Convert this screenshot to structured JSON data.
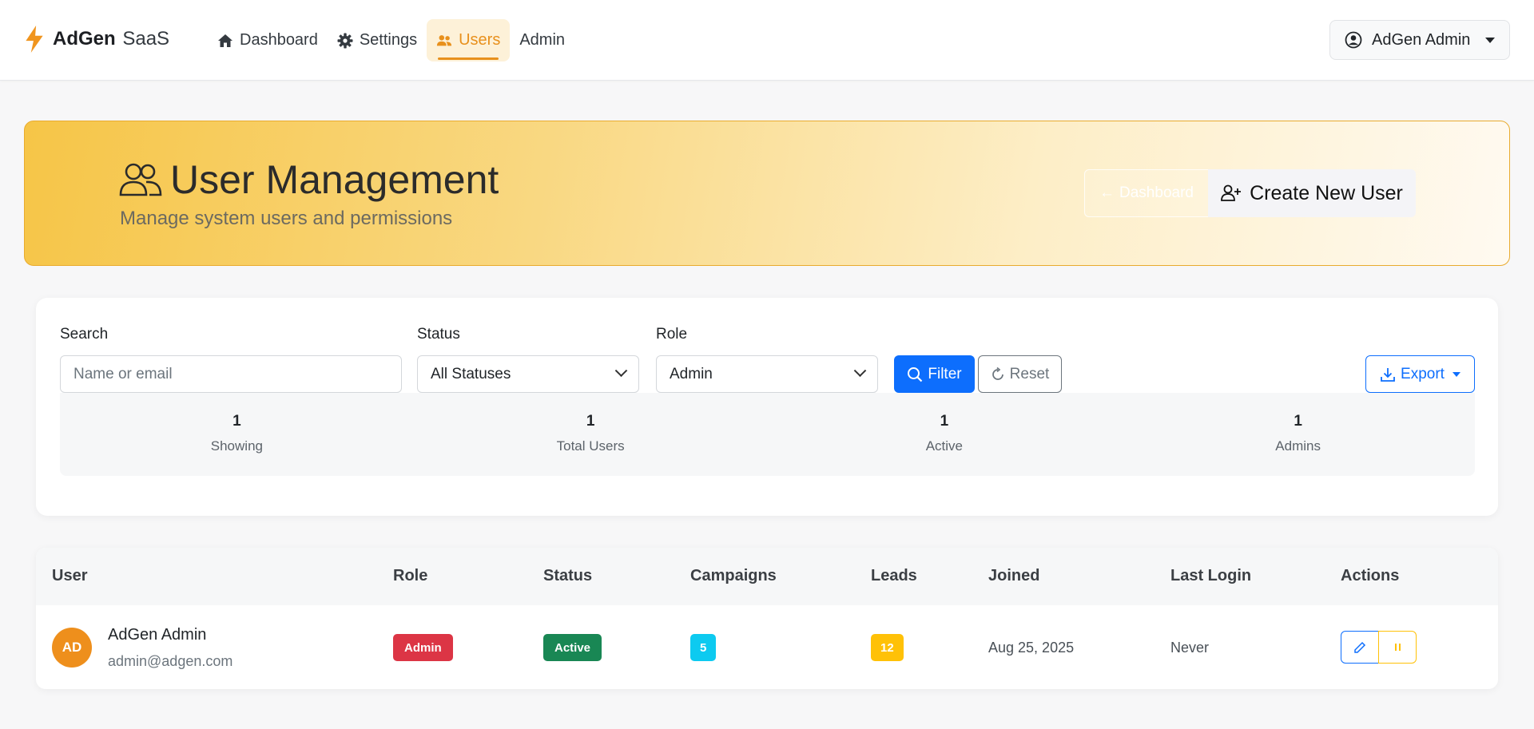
{
  "navbar": {
    "brand_strong": "AdGen",
    "brand_light": "SaaS",
    "items": [
      {
        "label": "Dashboard",
        "icon": "home-icon",
        "active": false
      },
      {
        "label": "Settings",
        "icon": "gear-icon",
        "active": false
      },
      {
        "label": "Users",
        "icon": "users-icon",
        "active": true
      },
      {
        "label": "Admin",
        "icon": "",
        "active": false
      }
    ],
    "user_menu_label": "AdGen Admin"
  },
  "hero": {
    "title": "User Management",
    "subtitle": "Manage system users and permissions",
    "back_button": "Dashboard",
    "create_button": "Create New User"
  },
  "filters": {
    "search_label": "Search",
    "search_placeholder": "Name or email",
    "status_label": "Status",
    "status_value": "All Statuses",
    "role_label": "Role",
    "role_value": "Admin",
    "filter_button": "Filter",
    "reset_button": "Reset",
    "export_button": "Export"
  },
  "stats": [
    {
      "value": "1",
      "label": "Showing"
    },
    {
      "value": "1",
      "label": "Total Users"
    },
    {
      "value": "1",
      "label": "Active"
    },
    {
      "value": "1",
      "label": "Admins"
    }
  ],
  "table": {
    "headers": [
      "User",
      "Role",
      "Status",
      "Campaigns",
      "Leads",
      "Joined",
      "Last Login",
      "Actions"
    ],
    "rows": [
      {
        "initials": "AD",
        "name": "AdGen Admin",
        "email": "admin@adgen.com",
        "role": "Admin",
        "status": "Active",
        "campaigns": "5",
        "leads": "12",
        "joined": "Aug 25, 2025",
        "last_login": "Never"
      }
    ]
  },
  "colors": {
    "accent": "#e8901c",
    "primary": "#0d6efd",
    "danger": "#dc3545",
    "success": "#198754",
    "info": "#0dcaf0",
    "warning": "#ffc107"
  }
}
